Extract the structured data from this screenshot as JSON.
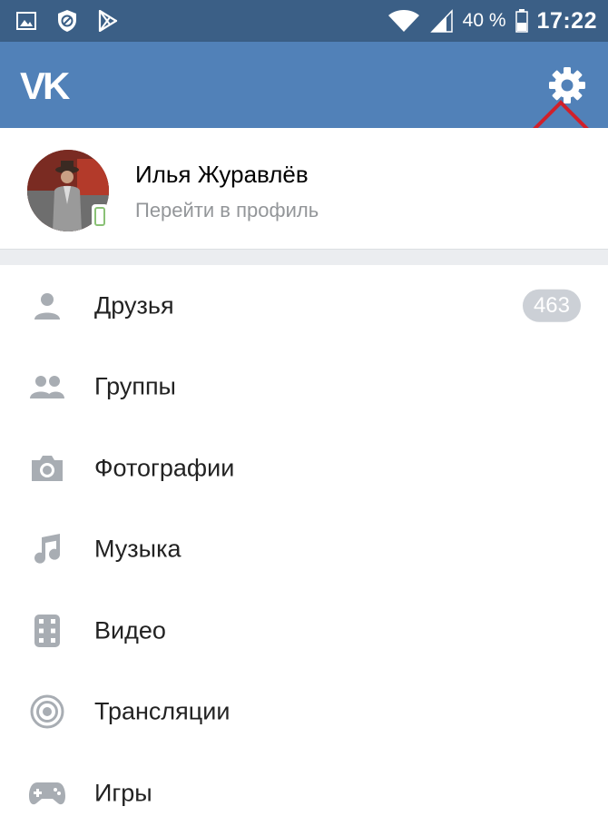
{
  "status_bar": {
    "battery_percent": "40 %",
    "time": "17:22",
    "left_icons": [
      "gallery-icon",
      "blocked-icon",
      "play-store-icon"
    ],
    "right_icons": [
      "wifi-icon",
      "signal-icon",
      "battery-icon"
    ]
  },
  "header": {
    "logo": "VK",
    "settings_icon": "gear-icon",
    "header_color": "#5181b8",
    "annotation_color": "#d0202a"
  },
  "profile": {
    "name": "Илья Журавлёв",
    "subtitle": "Перейти в профиль",
    "online_color": "#8ac176"
  },
  "menu": {
    "items": [
      {
        "label": "Друзья",
        "icon": "person-icon",
        "badge": "463"
      },
      {
        "label": "Группы",
        "icon": "people-icon"
      },
      {
        "label": "Фотографии",
        "icon": "camera-icon"
      },
      {
        "label": "Музыка",
        "icon": "music-note-icon"
      },
      {
        "label": "Видео",
        "icon": "film-icon"
      },
      {
        "label": "Трансляции",
        "icon": "broadcast-icon"
      },
      {
        "label": "Игры",
        "icon": "gamepad-icon"
      }
    ]
  }
}
